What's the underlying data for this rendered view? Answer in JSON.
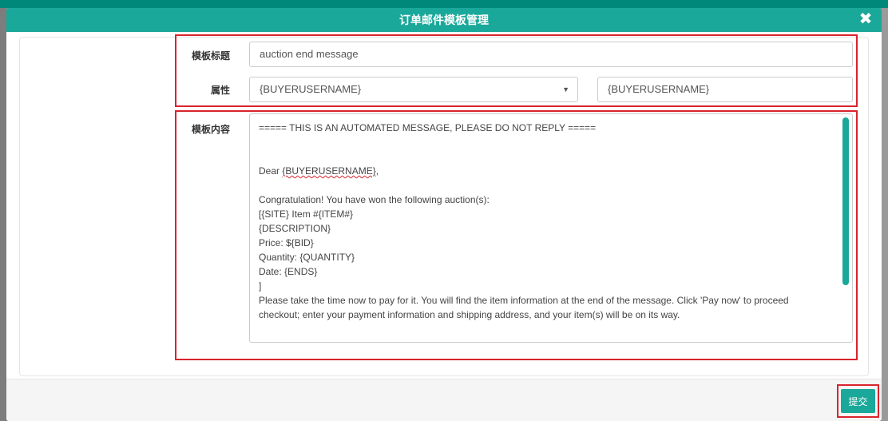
{
  "modal": {
    "title": "订单邮件模板管理",
    "close_icon": "times-icon"
  },
  "form": {
    "template_title_label": "模板标题",
    "template_title_value": "auction end message",
    "attribute_label": "属性",
    "attribute_selected": "{BUYERUSERNAME}",
    "attribute_text_value": "{BUYERUSERNAME}",
    "content_label": "模板内容",
    "content_lines": [
      "===== THIS IS AN AUTOMATED MESSAGE, PLEASE DO NOT REPLY =====",
      "",
      "",
      "Dear {BUYERUSERNAME},",
      "",
      "Congratulation! You have won the following auction(s):",
      "[{SITE} Item #{ITEM#}",
      "{DESCRIPTION}",
      "Price: ${BID}",
      "Quantity: {QUANTITY}",
      "Date: {ENDS}",
      "]",
      "Please take the time now to pay for it. You will find the item information at the end of the message. Click 'Pay now' to proceed",
      "checkout; enter your payment information and shipping address, and your item(s) will be on its way."
    ]
  },
  "footer": {
    "submit_label": "提交"
  },
  "colors": {
    "accent": "#1aa89a",
    "highlight_border": "#d9232d"
  }
}
